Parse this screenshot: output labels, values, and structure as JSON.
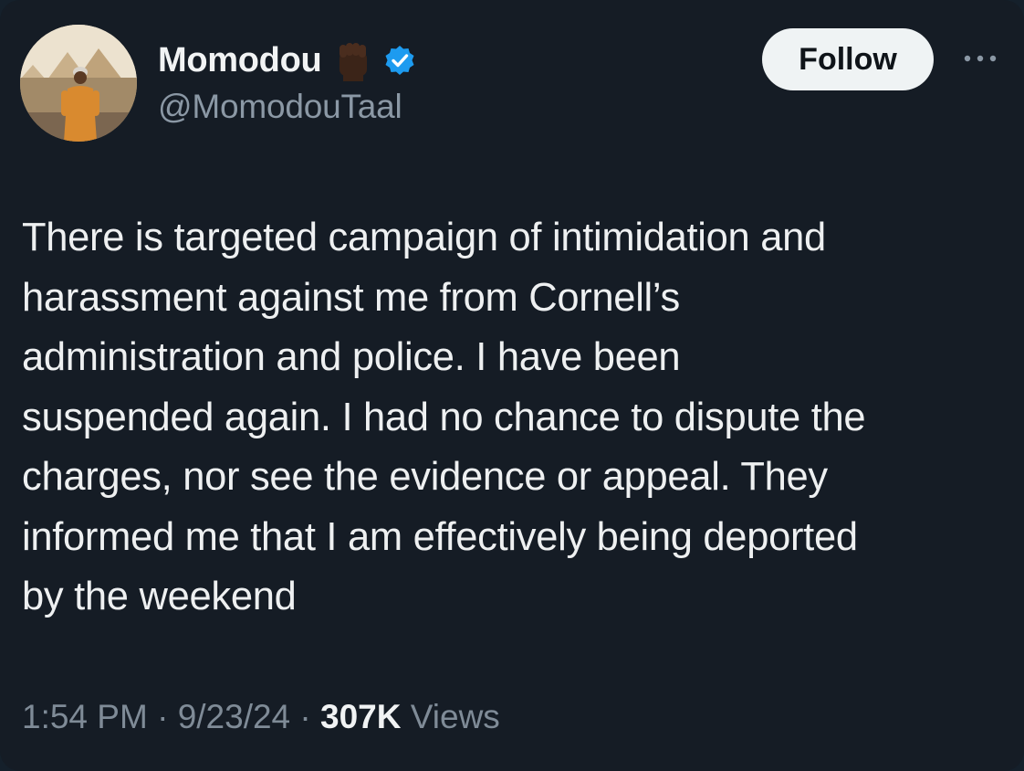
{
  "author": {
    "display_name": "Momodou",
    "handle": "@MomodouTaal",
    "emoji_icon": "raised-fist-dark-skin-icon",
    "verified_icon": "verified-badge-icon",
    "verified_color": "#1d9bf0"
  },
  "actions": {
    "follow_label": "Follow",
    "more_icon": "more-horizontal-icon"
  },
  "tweet": {
    "text": "There is targeted campaign of intimidation and\nharassment against me from Cornell’s\nadministration and police. I have been\nsuspended again. I had no chance to dispute the\ncharges, nor see the evidence or appeal. They\ninformed me that I am effectively being deported\nby the weekend"
  },
  "meta": {
    "time": "1:54 PM",
    "sep1": " · ",
    "date": "9/23/24",
    "sep2": " · ",
    "views_count": "307K",
    "views_label": " Views"
  },
  "colors": {
    "background": "#151c25",
    "text_primary": "#eef0f1",
    "text_secondary": "#8b98a5",
    "follow_bg": "#eff3f4"
  }
}
